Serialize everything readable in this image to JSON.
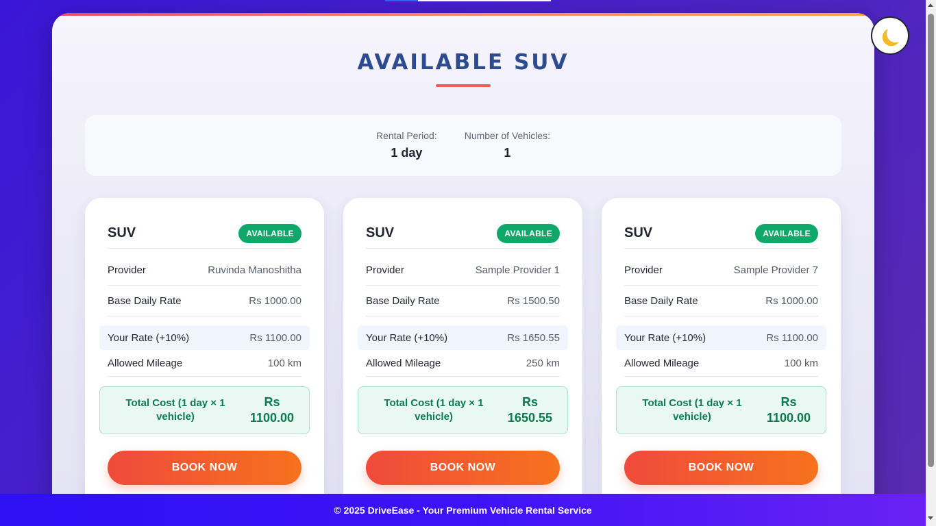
{
  "page": {
    "title": "AVAILABLE SUV"
  },
  "summary": {
    "rental_period_label": "Rental Period:",
    "rental_period_value": "1 day",
    "vehicles_label": "Number of Vehicles:",
    "vehicles_value": "1"
  },
  "cards": [
    {
      "type": "SUV",
      "status": "AVAILABLE",
      "provider_label": "Provider",
      "provider": "Ruvinda Manoshitha",
      "base_rate_label": "Base Daily Rate",
      "base_rate": "Rs 1000.00",
      "your_rate_label": "Your Rate (+10%)",
      "your_rate": "Rs 1100.00",
      "mileage_label": "Allowed Mileage",
      "mileage": "100 km",
      "total_label": "Total Cost (1 day × 1 vehicle)",
      "total_currency": "Rs",
      "total_amount": "1100.00",
      "book_label": "BOOK NOW"
    },
    {
      "type": "SUV",
      "status": "AVAILABLE",
      "provider_label": "Provider",
      "provider": "Sample Provider 1",
      "base_rate_label": "Base Daily Rate",
      "base_rate": "Rs 1500.50",
      "your_rate_label": "Your Rate (+10%)",
      "your_rate": "Rs 1650.55",
      "mileage_label": "Allowed Mileage",
      "mileage": "250 km",
      "total_label": "Total Cost (1 day × 1 vehicle)",
      "total_currency": "Rs",
      "total_amount": "1650.55",
      "book_label": "BOOK NOW"
    },
    {
      "type": "SUV",
      "status": "AVAILABLE",
      "provider_label": "Provider",
      "provider": "Sample Provider 7",
      "base_rate_label": "Base Daily Rate",
      "base_rate": "Rs 1000.00",
      "your_rate_label": "Your Rate (+10%)",
      "your_rate": "Rs 1100.00",
      "mileage_label": "Allowed Mileage",
      "mileage": "100 km",
      "total_label": "Total Cost (1 day × 1 vehicle)",
      "total_currency": "Rs",
      "total_amount": "1100.00",
      "book_label": "BOOK NOW"
    }
  ],
  "theme_toggle": {
    "icon": "moon-icon"
  },
  "footer": {
    "text": "© 2025 DriveEase - Your Premium Vehicle Rental Service"
  },
  "colors": {
    "background_start": "#3a16d8",
    "accent_red": "#ef4a3c",
    "accent_orange": "#f7721d",
    "available_green": "#10a86a",
    "title_blue": "#2c4c8f"
  }
}
